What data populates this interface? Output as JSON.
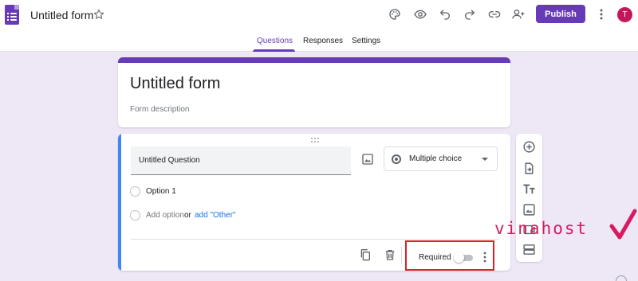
{
  "header": {
    "form_title": "Untitled form",
    "publish_label": "Publish",
    "avatar_initial": "T",
    "icons": [
      "palette-icon",
      "preview-eye-icon",
      "undo-icon",
      "redo-icon",
      "link-icon",
      "add-collaborator-icon"
    ]
  },
  "tabs": [
    {
      "label": "Questions",
      "active": true
    },
    {
      "label": "Responses",
      "active": false
    },
    {
      "label": "Settings",
      "active": false
    }
  ],
  "form": {
    "title": "Untitled form",
    "description_placeholder": "Form description"
  },
  "question": {
    "title": "Untitled Question",
    "type": "Multiple choice",
    "options": [
      {
        "label": "Option 1"
      }
    ],
    "add_option_label": "Add option",
    "or_label": "or",
    "add_other_label": "add \"Other\"",
    "required_label": "Required",
    "required": false
  },
  "side_toolbar": [
    "add-question-icon",
    "import-questions-icon",
    "add-title-icon",
    "add-image-icon",
    "add-video-icon",
    "add-section-icon"
  ],
  "watermark": {
    "text": "vinahost"
  },
  "colors": {
    "brand": "#673ab7",
    "background": "#ede7f6",
    "question_accent": "#4285f4",
    "link": "#1a73e8",
    "highlight": "#e31e24",
    "watermark": "#d81b60"
  }
}
